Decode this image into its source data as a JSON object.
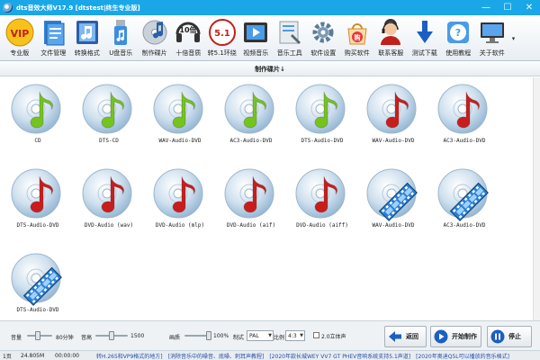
{
  "window": {
    "title": "dts音效大师V17.9 [dtstest|终生专业版]",
    "minimize": "—",
    "maximize": "☐",
    "close": "✕"
  },
  "toolbar": {
    "items": [
      {
        "label": "专业版",
        "icon": "vip-icon"
      },
      {
        "label": "文件管理",
        "icon": "file-manager-icon"
      },
      {
        "label": "转换格式",
        "icon": "convert-format-icon"
      },
      {
        "label": "U盘音乐",
        "icon": "usb-music-icon"
      },
      {
        "label": "制作碟片",
        "icon": "disc-maker-icon",
        "badge": ""
      },
      {
        "label": "十倍音质",
        "icon": "ten-times-quality-icon",
        "badge": "10倍"
      },
      {
        "label": "转5.1环绕",
        "icon": "surround-5-1-icon",
        "badge": "5.1"
      },
      {
        "label": "视频音乐",
        "icon": "video-music-icon"
      },
      {
        "label": "音乐工具",
        "icon": "music-tools-icon"
      },
      {
        "label": "软件设置",
        "icon": "settings-gear-icon"
      },
      {
        "label": "购买软件",
        "icon": "buy-software-icon",
        "badge": "购"
      },
      {
        "label": "联系客服",
        "icon": "customer-service-icon"
      },
      {
        "label": "测试下载",
        "icon": "test-download-icon"
      },
      {
        "label": "使用教程",
        "icon": "help-tutorial-icon",
        "badge": "?"
      },
      {
        "label": "关于软件",
        "icon": "about-software-icon"
      }
    ],
    "more": "▾"
  },
  "section": {
    "title": "制作碟片↓"
  },
  "items": [
    {
      "label": "CD",
      "kind": "music",
      "note_color": "#74c41e"
    },
    {
      "label": "DTS-CD",
      "kind": "music",
      "note_color": "#74c41e"
    },
    {
      "label": "WAV-Audio-DVD",
      "kind": "music",
      "note_color": "#74c41e"
    },
    {
      "label": "AC3-Audio-DVD",
      "kind": "music",
      "note_color": "#74c41e"
    },
    {
      "label": "DTS-Audio-DVD",
      "kind": "music",
      "note_color": "#74c41e"
    },
    {
      "label": "WAV-Audio-DVD",
      "kind": "music",
      "note_color": "#c91d1d"
    },
    {
      "label": "AC3-Audio-DVD",
      "kind": "music",
      "note_color": "#c91d1d"
    },
    {
      "label": "DTS-Audio-DVD",
      "kind": "music",
      "note_color": "#c91d1d"
    },
    {
      "label": "DVD-Audio (wav)",
      "kind": "music",
      "note_color": "#c91d1d"
    },
    {
      "label": "DVD-Audio (mlp)",
      "kind": "music",
      "note_color": "#c91d1d"
    },
    {
      "label": "DVD-Audio (aif)",
      "kind": "music",
      "note_color": "#c91d1d"
    },
    {
      "label": "DVD-Audio (aiff)",
      "kind": "music",
      "note_color": "#c91d1d"
    },
    {
      "label": "WAV-Audio-DVD",
      "kind": "film"
    },
    {
      "label": "AC3-Audio-DVD",
      "kind": "film"
    },
    {
      "label": "DTS-Audio-DVD",
      "kind": "film"
    }
  ],
  "controls": {
    "volume_label": "音量",
    "volume_value": "80分钟",
    "volume_level": 0.4,
    "pitch_label": "音高",
    "pitch_value": "1500",
    "pitch_level": 0.5,
    "quality_label": "画质",
    "quality_value": "100%",
    "quality_level": 1.0,
    "format_label": "制式",
    "format_value": "PAL",
    "ratio_label": "比例",
    "ratio_value": "4:3",
    "stereo_label": "2.0立体声",
    "stereo_checked": false,
    "back_label": "返回",
    "start_label": "开始制作",
    "stop_label": "停止"
  },
  "status": {
    "page": "1页",
    "size": "24.805M",
    "time": "00:00:00",
    "msg1": "转H.265和VP9格式的地方]",
    "msg2": "[消除音乐中的噪音、底噪、刺耳声教程]",
    "msg3": "[2020年款长城WEY VV7 GT PHEV音响系统支持5.1声道]",
    "msg4": "[2020年奥迪Q5L可以播放的音乐格式]"
  },
  "colors": {
    "titlebar": "#1aa7e8",
    "accent_blue": "#1f4fa8",
    "note_green": "#74c41e",
    "note_red": "#c91d1d",
    "film_blue": "#2a7fd4"
  }
}
